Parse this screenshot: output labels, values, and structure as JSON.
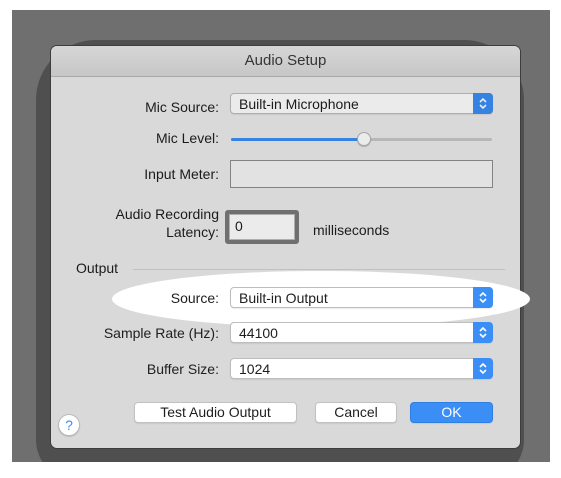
{
  "dialog": {
    "title": "Audio Setup"
  },
  "mic_source": {
    "label": "Mic Source:",
    "value": "Built-in Microphone"
  },
  "mic_level": {
    "label": "Mic Level:",
    "level_fraction": 0.51
  },
  "input_meter": {
    "label": "Input Meter:"
  },
  "latency": {
    "label_line1": "Audio Recording",
    "label_line2": "Latency:",
    "value": "0",
    "unit": "milliseconds"
  },
  "output_section": {
    "heading": "Output"
  },
  "source": {
    "label": "Source:",
    "value": "Built-in Output"
  },
  "sample_rate": {
    "label": "Sample Rate (Hz):",
    "value": "44100"
  },
  "buffer_size": {
    "label": "Buffer Size:",
    "value": "1024"
  },
  "buttons": {
    "help": "?",
    "test": "Test Audio Output",
    "cancel": "Cancel",
    "ok": "OK"
  },
  "icons": {
    "popup_arrows": "chevron-up-down-icon",
    "help": "question-mark-icon"
  },
  "colors": {
    "accent": "#3a8ef5"
  }
}
